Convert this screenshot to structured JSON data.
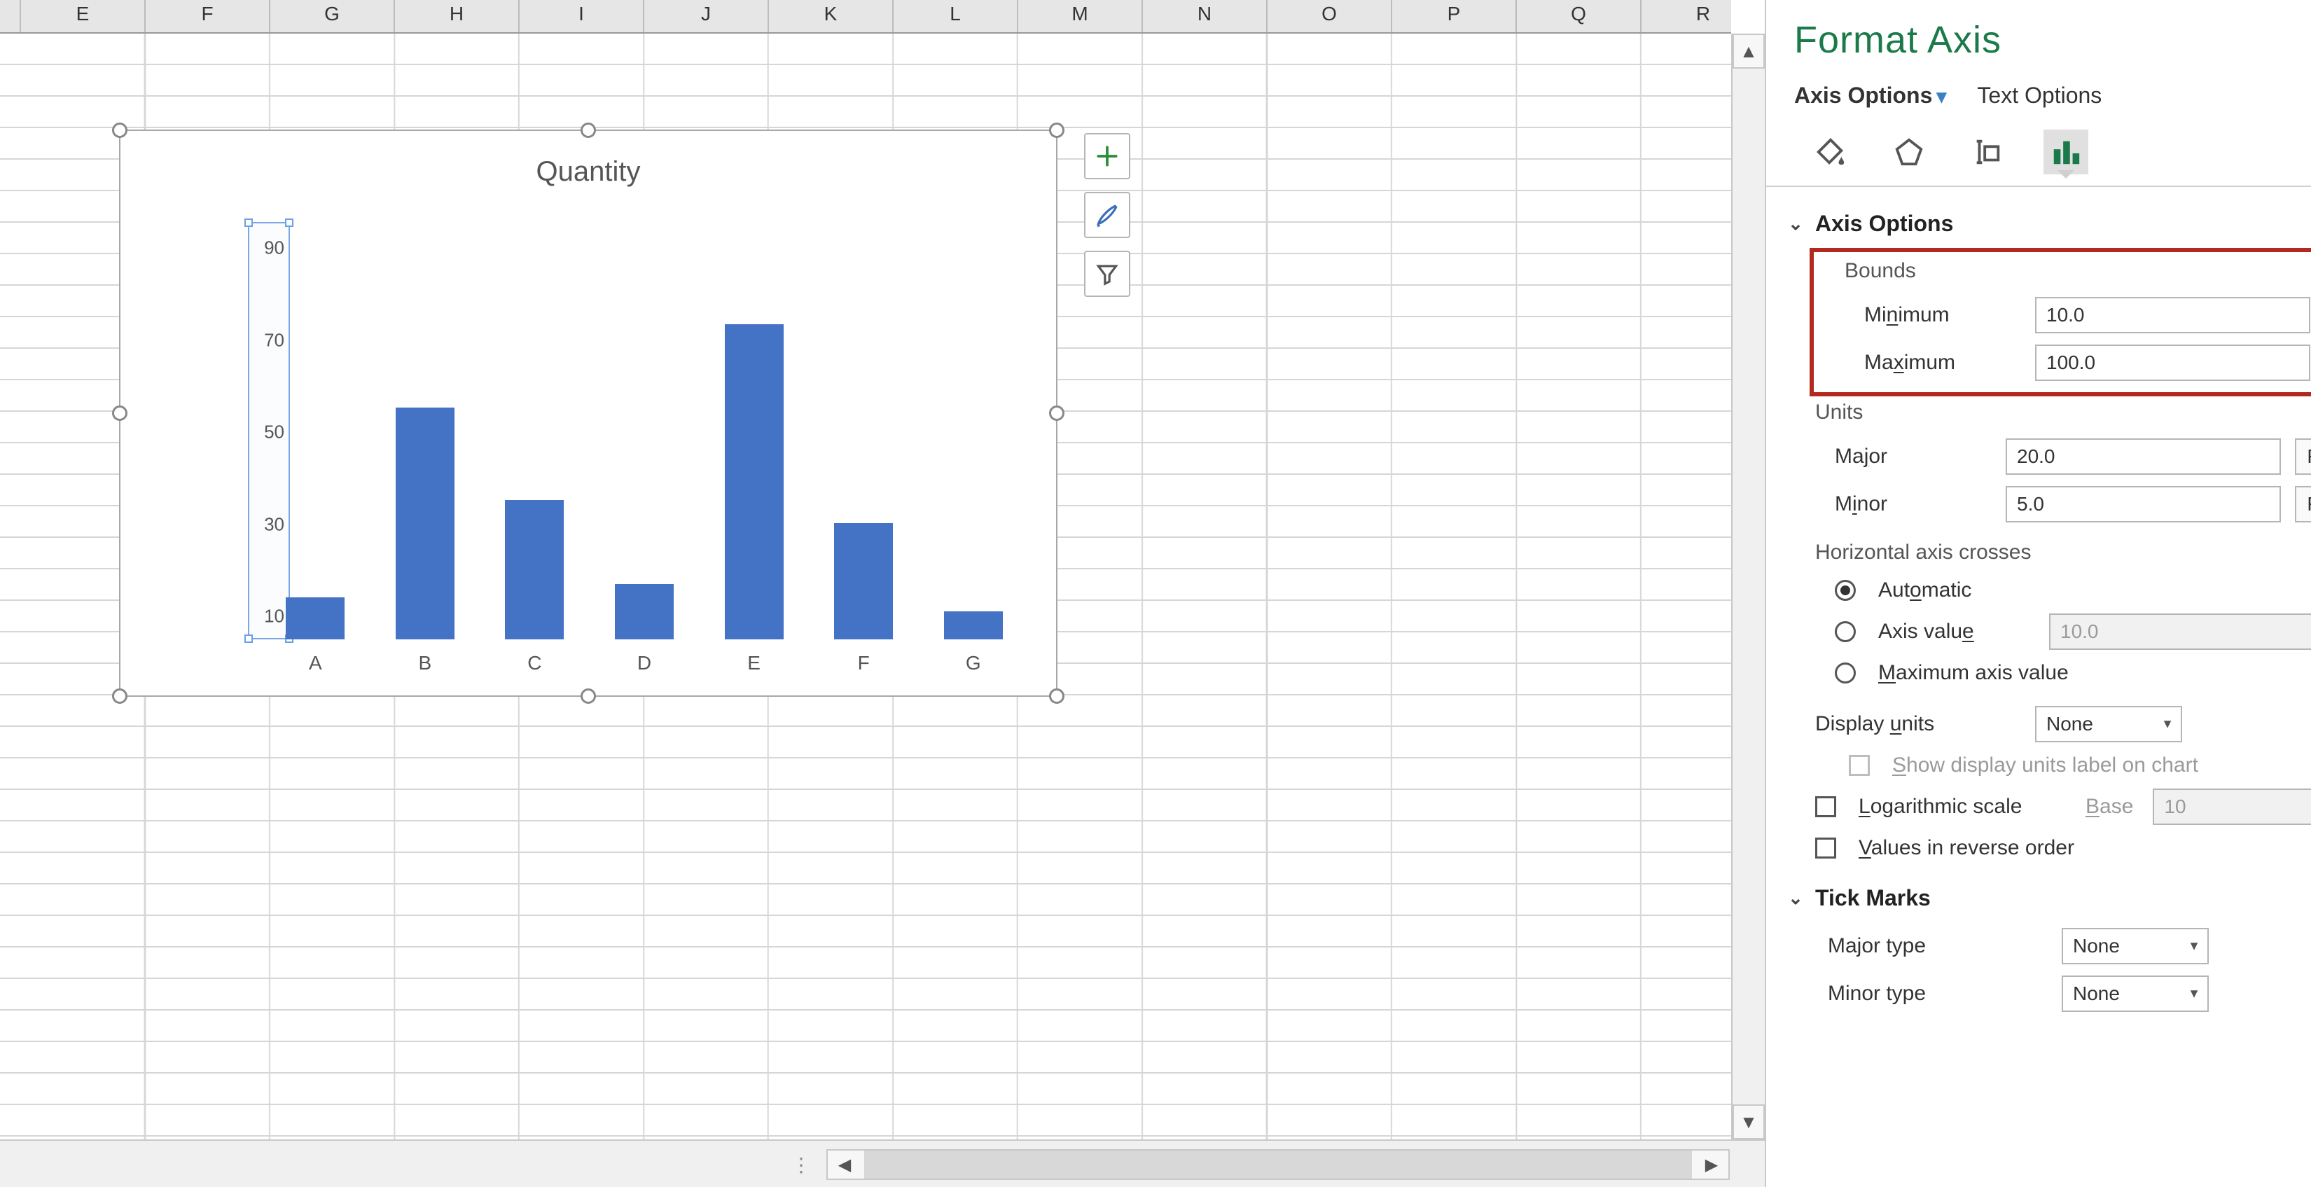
{
  "columns": [
    "E",
    "F",
    "G",
    "H",
    "I",
    "J",
    "K",
    "L",
    "M",
    "N",
    "O",
    "P",
    "Q",
    "R"
  ],
  "chart_data": {
    "type": "bar",
    "title": "Quantity",
    "categories": [
      "A",
      "B",
      "C",
      "D",
      "E",
      "F",
      "G"
    ],
    "values": [
      19,
      60,
      40,
      22,
      78,
      35,
      16
    ],
    "y_ticks": [
      10,
      30,
      50,
      70,
      90
    ],
    "ylim": [
      10,
      100
    ],
    "xlabel": "",
    "ylabel": ""
  },
  "chart_buttons": {
    "add_element": "+",
    "styles": "brush",
    "filter": "funnel"
  },
  "pane": {
    "title": "Format Axis",
    "tab_axis_options": "Axis Options",
    "tab_text_options": "Text Options",
    "nav_icons": {
      "fill": "fill-bucket",
      "effects": "pentagon",
      "size": "size-props",
      "axis": "bar-chart"
    },
    "section_axis_options": "Axis Options",
    "bounds_label": "Bounds",
    "min_label": "Minimum",
    "min_value": "10.0",
    "max_label": "Maximum",
    "max_value": "100.0",
    "reset_label": "Reset",
    "units_label": "Units",
    "major_label": "Major",
    "major_value": "20.0",
    "minor_label": "Minor",
    "minor_value": "5.0",
    "hcross_label": "Horizontal axis crosses",
    "hcross_auto": "Automatic",
    "hcross_axisvalue": "Axis value",
    "hcross_axisvalue_input": "10.0",
    "hcross_max": "Maximum axis value",
    "display_units_label": "Display units",
    "display_units_value": "None",
    "show_units_label": "Show display units label on chart",
    "log_label": "Logarithmic scale",
    "log_base_label": "Base",
    "log_base_value": "10",
    "reverse_label": "Values in reverse order",
    "section_tick_marks": "Tick Marks",
    "tick_major_label": "Major type",
    "tick_major_value": "None",
    "tick_minor_label": "Minor type",
    "tick_minor_value": "None"
  }
}
